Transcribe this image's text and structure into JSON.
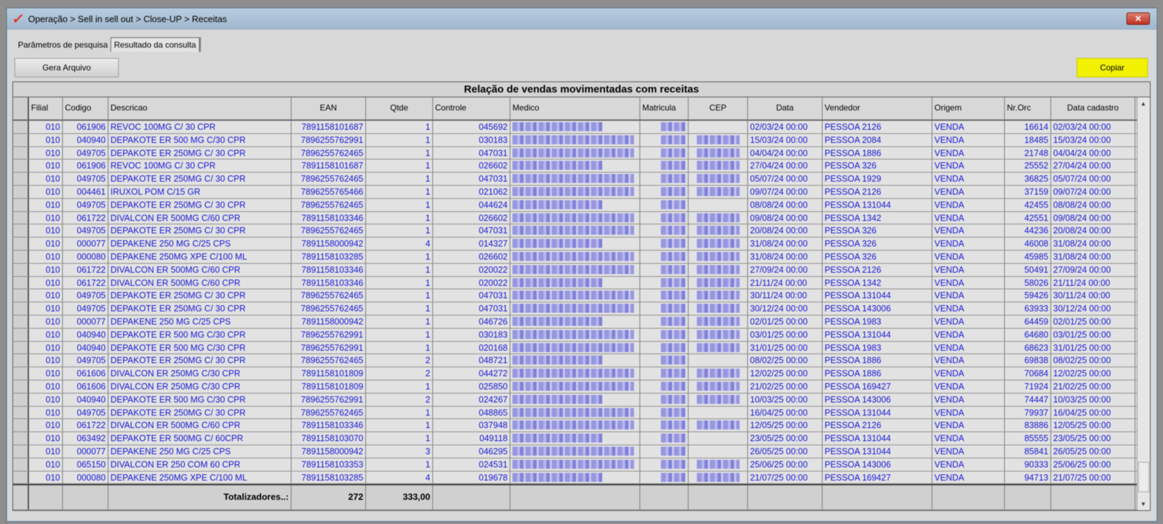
{
  "window": {
    "title": "Operação > Sell in sell out > Close-UP > Receitas",
    "close": "✕"
  },
  "tabs": [
    {
      "label": "Parâmetros de pesquisa"
    },
    {
      "label": "Resultado da consulta"
    }
  ],
  "toolbar": {
    "gera_arquivo": "Gera Arquivo",
    "copiar": "Copiar",
    "copiar_color": "#f2f200"
  },
  "grid": {
    "title": "Relação de vendas movimentadas com receitas",
    "columns": [
      "Filial",
      "Codigo",
      "Descricao",
      "EAN",
      "Qtde",
      "Controle",
      "Medico",
      "Matricula",
      "CEP",
      "Data",
      "Vendedor",
      "Origem",
      "Nr.Orc",
      "Data cadastro"
    ],
    "rows": [
      [
        "010",
        "061906",
        "REVOC 100MG C/ 30 CPR",
        "7891158101687",
        "1",
        "045692",
        false,
        "02/03/24 00:00",
        "PESSOA 2126",
        "VENDA",
        "16614",
        "02/03/24 00:00"
      ],
      [
        "010",
        "040940",
        "DEPAKOTE ER 500 MG C/30 CPR",
        "7896255762991",
        "1",
        "030183",
        true,
        "15/03/24 00:00",
        "PESSOA 2084",
        "VENDA",
        "18485",
        "15/03/24 00:00"
      ],
      [
        "010",
        "049705",
        "DEPAKOTE ER 250MG C/ 30 CPR",
        "7896255762465",
        "1",
        "047031",
        true,
        "04/04/24 00:00",
        "PESSOA 1886",
        "VENDA",
        "21748",
        "04/04/24 00:00"
      ],
      [
        "010",
        "061906",
        "REVOC 100MG C/ 30 CPR",
        "7891158101687",
        "1",
        "026602",
        true,
        "27/04/24 00:00",
        "PESSOA 326",
        "VENDA",
        "25552",
        "27/04/24 00:00"
      ],
      [
        "010",
        "049705",
        "DEPAKOTE ER 250MG C/ 30 CPR",
        "7896255762465",
        "1",
        "047031",
        true,
        "05/07/24 00:00",
        "PESSOA 1929",
        "VENDA",
        "36825",
        "05/07/24 00:00"
      ],
      [
        "010",
        "004461",
        "IRUXOL POM C/15 GR",
        "7896255765466",
        "1",
        "021062",
        true,
        "09/07/24 00:00",
        "PESSOA 2126",
        "VENDA",
        "37159",
        "09/07/24 00:00"
      ],
      [
        "010",
        "049705",
        "DEPAKOTE ER 250MG C/ 30 CPR",
        "7896255762465",
        "1",
        "044624",
        false,
        "08/08/24 00:00",
        "PESSOA 131044",
        "VENDA",
        "42455",
        "08/08/24 00:00"
      ],
      [
        "010",
        "061722",
        "DIVALCON ER 500MG C/60 CPR",
        "7891158103346",
        "1",
        "026602",
        true,
        "09/08/24 00:00",
        "PESSOA 1342",
        "VENDA",
        "42551",
        "09/08/24 00:00"
      ],
      [
        "010",
        "049705",
        "DEPAKOTE ER 250MG C/ 30 CPR",
        "7896255762465",
        "1",
        "047031",
        true,
        "20/08/24 00:00",
        "PESSOA 326",
        "VENDA",
        "44236",
        "20/08/24 00:00"
      ],
      [
        "010",
        "000077",
        "DEPAKENE 250 MG C/25 CPS",
        "7891158000942",
        "4",
        "014327",
        true,
        "31/08/24 00:00",
        "PESSOA 326",
        "VENDA",
        "46008",
        "31/08/24 00:00"
      ],
      [
        "010",
        "000080",
        "DEPAKENE 250MG XPE C/100 ML",
        "7891158103285",
        "1",
        "026602",
        true,
        "31/08/24 00:00",
        "PESSOA 326",
        "VENDA",
        "45985",
        "31/08/24 00:00"
      ],
      [
        "010",
        "061722",
        "DIVALCON ER 500MG C/60 CPR",
        "7891158103346",
        "1",
        "020022",
        true,
        "27/09/24 00:00",
        "PESSOA 2126",
        "VENDA",
        "50491",
        "27/09/24 00:00"
      ],
      [
        "010",
        "061722",
        "DIVALCON ER 500MG C/60 CPR",
        "7891158103346",
        "1",
        "020022",
        true,
        "21/11/24 00:00",
        "PESSOA 1342",
        "VENDA",
        "58026",
        "21/11/24 00:00"
      ],
      [
        "010",
        "049705",
        "DEPAKOTE ER 250MG C/ 30 CPR",
        "7896255762465",
        "1",
        "047031",
        true,
        "30/11/24 00:00",
        "PESSOA 131044",
        "VENDA",
        "59426",
        "30/11/24 00:00"
      ],
      [
        "010",
        "049705",
        "DEPAKOTE ER 250MG C/ 30 CPR",
        "7896255762465",
        "1",
        "047031",
        true,
        "30/12/24 00:00",
        "PESSOA 143006",
        "VENDA",
        "63933",
        "30/12/24 00:00"
      ],
      [
        "010",
        "000077",
        "DEPAKENE 250 MG C/25 CPS",
        "7891158000942",
        "1",
        "046726",
        true,
        "02/01/25 00:00",
        "PESSOA 1983",
        "VENDA",
        "64459",
        "02/01/25 00:00"
      ],
      [
        "010",
        "040940",
        "DEPAKOTE ER 500 MG C/30 CPR",
        "7896255762991",
        "1",
        "030183",
        true,
        "03/01/25 00:00",
        "PESSOA 131044",
        "VENDA",
        "64680",
        "03/01/25 00:00"
      ],
      [
        "010",
        "040940",
        "DEPAKOTE ER 500 MG C/30 CPR",
        "7896255762991",
        "1",
        "020168",
        true,
        "31/01/25 00:00",
        "PESSOA 1983",
        "VENDA",
        "68623",
        "31/01/25 00:00"
      ],
      [
        "010",
        "049705",
        "DEPAKOTE ER 250MG C/ 30 CPR",
        "7896255762465",
        "2",
        "048721",
        false,
        "08/02/25 00:00",
        "PESSOA 1886",
        "VENDA",
        "69838",
        "08/02/25 00:00"
      ],
      [
        "010",
        "061606",
        "DIVALCON ER 250MG C/30 CPR",
        "7891158101809",
        "2",
        "044272",
        true,
        "12/02/25 00:00",
        "PESSOA 1886",
        "VENDA",
        "70684",
        "12/02/25 00:00"
      ],
      [
        "010",
        "061606",
        "DIVALCON ER 250MG C/30 CPR",
        "7891158101809",
        "1",
        "025850",
        true,
        "21/02/25 00:00",
        "PESSOA 169427",
        "VENDA",
        "71924",
        "21/02/25 00:00"
      ],
      [
        "010",
        "040940",
        "DEPAKOTE ER 500 MG C/30 CPR",
        "7896255762991",
        "2",
        "024267",
        true,
        "10/03/25 00:00",
        "PESSOA 143006",
        "VENDA",
        "74447",
        "10/03/25 00:00"
      ],
      [
        "010",
        "049705",
        "DEPAKOTE ER 250MG C/ 30 CPR",
        "7896255762465",
        "1",
        "048865",
        false,
        "16/04/25 00:00",
        "PESSOA 131044",
        "VENDA",
        "79937",
        "16/04/25 00:00"
      ],
      [
        "010",
        "061722",
        "DIVALCON ER 500MG C/60 CPR",
        "7891158103346",
        "1",
        "037948",
        true,
        "12/05/25 00:00",
        "PESSOA 2126",
        "VENDA",
        "83886",
        "12/05/25 00:00"
      ],
      [
        "010",
        "063492",
        "DEPAKOTE ER 500MG C/ 60CPR",
        "7891158103070",
        "1",
        "049118",
        false,
        "23/05/25 00:00",
        "PESSOA 131044",
        "VENDA",
        "85555",
        "23/05/25 00:00"
      ],
      [
        "010",
        "000077",
        "DEPAKENE 250 MG C/25 CPS",
        "7891158000942",
        "3",
        "046295",
        false,
        "26/05/25 00:00",
        "PESSOA 131044",
        "VENDA",
        "85841",
        "26/05/25 00:00"
      ],
      [
        "010",
        "065150",
        "DIVALCON ER 250 COM 60 CPR",
        "7891158103353",
        "1",
        "024531",
        true,
        "25/06/25 00:00",
        "PESSOA 143006",
        "VENDA",
        "90333",
        "25/06/25 00:00"
      ],
      [
        "010",
        "000080",
        "DEPAKENE 250MG XPE C/100 ML",
        "7891158103285",
        "4",
        "019678",
        true,
        "21/07/25 00:00",
        "PESSOA 169427",
        "VENDA",
        "94713",
        "21/07/25 00:00"
      ]
    ],
    "footer": {
      "label": "Totalizadores..:",
      "ean_total": "272",
      "qtde_total": "333,00"
    }
  }
}
